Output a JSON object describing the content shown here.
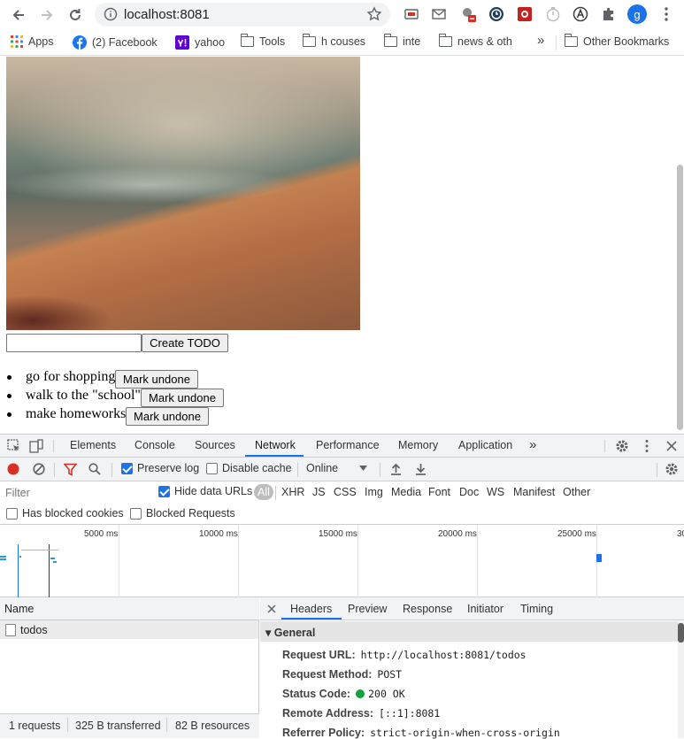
{
  "browser": {
    "url": "localhost:8081",
    "profile_initial": "g",
    "bookmarks": [
      "Apps",
      "(2) Facebook",
      "yahoo",
      "Tools",
      "h couses",
      "inte",
      "news & oth"
    ],
    "other_bookmarks": "Other Bookmarks",
    "overflow_label": "»"
  },
  "page": {
    "create_button": "Create TODO",
    "todo_input_value": "",
    "todos": [
      {
        "text": "go for shopping",
        "button": "Mark undone"
      },
      {
        "text": "walk to the \"school\"",
        "button": "Mark undone"
      },
      {
        "text": "make homeworks",
        "button": "Mark undone"
      }
    ]
  },
  "devtools": {
    "tabs": [
      "Elements",
      "Console",
      "Sources",
      "Network",
      "Performance",
      "Memory",
      "Application"
    ],
    "active_tab": "Network",
    "more_tabs": "»",
    "toolbar": {
      "preserve_log": "Preserve log",
      "disable_cache": "Disable cache",
      "throttle": "Online"
    },
    "filter": {
      "placeholder": "Filter",
      "hide_data_urls": "Hide data URLs",
      "types": [
        "All",
        "XHR",
        "JS",
        "CSS",
        "Img",
        "Media",
        "Font",
        "Doc",
        "WS",
        "Manifest",
        "Other"
      ],
      "has_blocked_cookies": "Has blocked cookies",
      "blocked_requests": "Blocked Requests"
    },
    "timeline_ticks": [
      "5000 ms",
      "10000 ms",
      "15000 ms",
      "20000 ms",
      "25000 ms",
      "30"
    ],
    "requests": {
      "column": "Name",
      "rows": [
        "todos"
      ]
    },
    "status_bar": [
      "1 requests",
      "325 B transferred",
      "82 B resources"
    ],
    "detail_tabs": [
      "Headers",
      "Preview",
      "Response",
      "Initiator",
      "Timing"
    ],
    "active_detail_tab": "Headers",
    "general": {
      "title": "General",
      "fields": [
        {
          "key": "Request URL:",
          "value": "http://localhost:8081/todos"
        },
        {
          "key": "Request Method:",
          "value": "POST"
        },
        {
          "key": "Status Code:",
          "value": "200 OK"
        },
        {
          "key": "Remote Address:",
          "value": "[::1]:8081"
        },
        {
          "key": "Referrer Policy:",
          "value": "strict-origin-when-cross-origin"
        }
      ]
    },
    "colors": {
      "accent": "#1a73e8",
      "status_ok": "#0ea33a",
      "record": "#d93025",
      "filter": "#d93025"
    }
  }
}
